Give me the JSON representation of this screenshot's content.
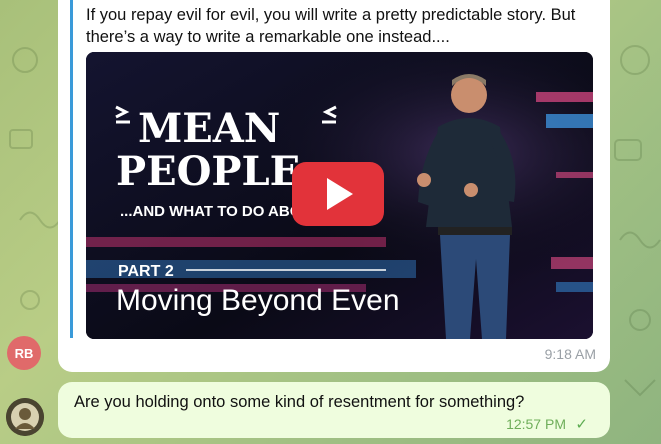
{
  "messages": [
    {
      "text": "If you repay evil for evil, you will write a pretty predictable story. But there’s a way to write a remarkable one instead....",
      "preview": {
        "title_line1": "MEAN",
        "title_line2": "PEOPLE",
        "subtitle": "...AND WHAT TO DO ABOUT THEM",
        "part": "PART 2",
        "episode": "Moving Beyond Even"
      },
      "time": "9:18 AM",
      "sender_initials": "RB"
    },
    {
      "text": "Are you holding onto some kind of resentment for something?",
      "time": "12:57 PM",
      "status": "✓"
    }
  ],
  "colors": {
    "incoming_bubble": "#ffffff",
    "outgoing_bubble": "#effdde",
    "quote_bar": "#3a9ad9",
    "avatar_rb": "#e06a6a",
    "play_button": "#e2333a"
  },
  "icons": {
    "play": "play-icon",
    "read_check": "checkmark-icon"
  }
}
